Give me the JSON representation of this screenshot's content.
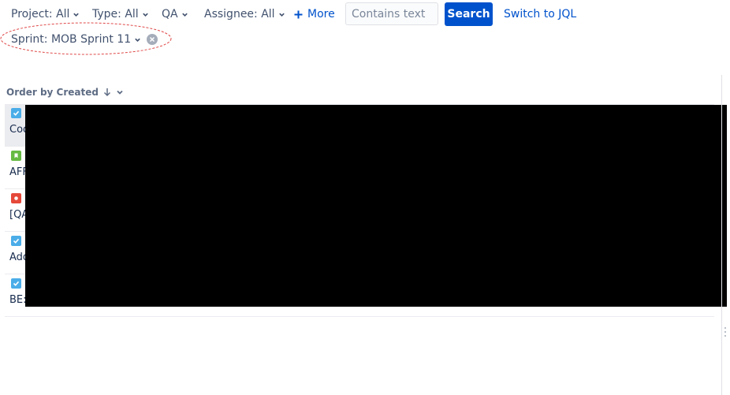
{
  "filters": {
    "project": "Project: All",
    "type": "Type: All",
    "status": "QA",
    "assignee": "Assignee: All",
    "more": "More",
    "search_placeholder": "Contains text",
    "search_button": "Search",
    "switch_jql": "Switch to JQL",
    "sprint_chip": "Sprint: MOB Sprint 11"
  },
  "list": {
    "order_by": "Order by Created",
    "issues": [
      {
        "type": "task",
        "summary": "Coo",
        "selected": true
      },
      {
        "type": "story",
        "summary": "AFF",
        "selected": false
      },
      {
        "type": "bug",
        "summary": "[QA",
        "selected": false
      },
      {
        "type": "task",
        "summary": "Add",
        "selected": false
      },
      {
        "type": "task",
        "summary": "BE:",
        "selected": false
      }
    ]
  },
  "colors": {
    "accent": "#0052cc",
    "task": "#4bade8",
    "story": "#65ba43",
    "bug": "#e5493a",
    "annotation": "#e04848"
  }
}
